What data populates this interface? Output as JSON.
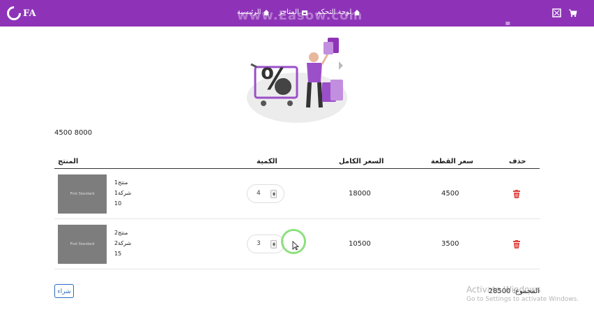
{
  "navbar": {
    "brand": "FA",
    "links": [
      "لوحة التحكم",
      "المتاجر",
      "الرئيسية"
    ],
    "watermark": "www.Easow.com",
    "watermark2": "wavipo"
  },
  "summary_numbers": "4500 8000",
  "table": {
    "headers": {
      "product": "المنتج",
      "quantity": "الكمية",
      "full_price": "السعر الكامل",
      "unit_price": "سعر القطعة",
      "delete": "حذف"
    },
    "rows": [
      {
        "image_text": "First Standard",
        "name": "منتج1",
        "company": "شركة1",
        "stock": "10",
        "quantity": "4",
        "full_price": "18000",
        "unit_price": "4500"
      },
      {
        "image_text": "First Standard",
        "name": "منتج2",
        "company": "شركة2",
        "stock": "15",
        "quantity": "3",
        "full_price": "10500",
        "unit_price": "3500"
      }
    ]
  },
  "buy_label": "شراء",
  "total_label": "المجموع: 28500",
  "activation": {
    "title": "Activate Windows",
    "subtitle": "Go to Settings to activate Windows."
  },
  "colors": {
    "nav_bg": "#8e33b8",
    "accent": "#2a6cb8",
    "delete": "#e0413d"
  }
}
